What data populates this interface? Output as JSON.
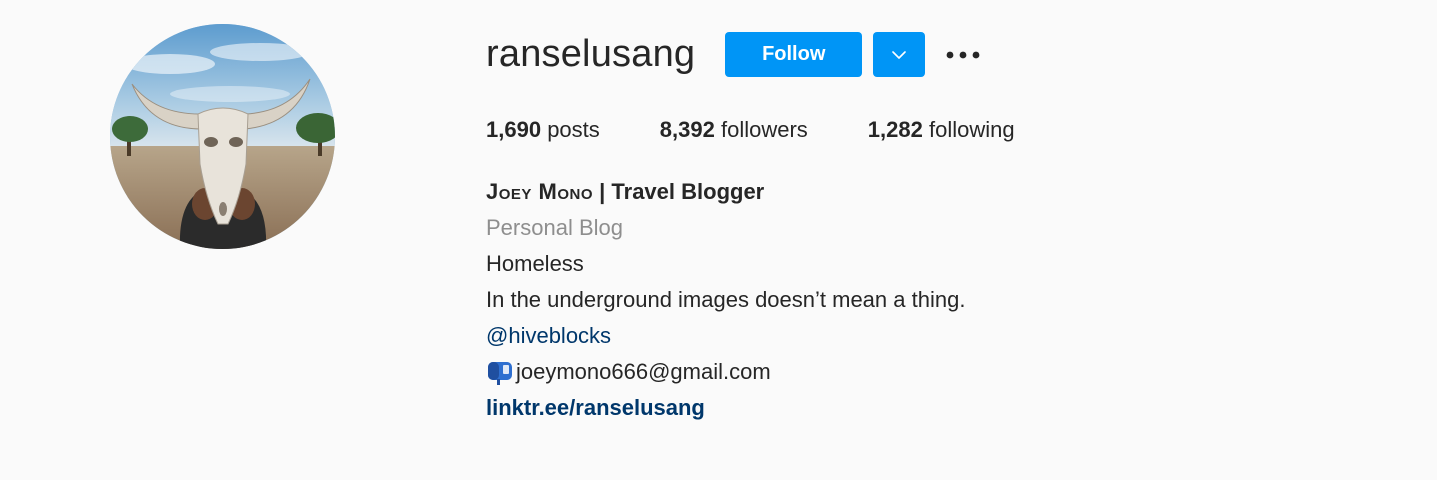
{
  "profile": {
    "username": "ranselusang",
    "follow_label": "Follow",
    "icons": {
      "dropdown": "chevron-down-icon",
      "more": "more-options-icon",
      "email_prefix": "mailbox-icon"
    }
  },
  "stats": {
    "posts_count": "1,690",
    "posts_label": "posts",
    "followers_count": "8,392",
    "followers_label": "followers",
    "following_count": "1,282",
    "following_label": "following"
  },
  "bio": {
    "name_caps": "Joey Mono",
    "name_rest": " | Travel Blogger",
    "category": "Personal Blog",
    "line1": "Homeless",
    "line2": "In the underground images doesn’t mean a thing.",
    "mention": "@hiveblocks",
    "email": "joeymono666@gmail.com",
    "link": "linktr.ee/ranselusang"
  },
  "colors": {
    "background": "#fafafa",
    "primary_button": "#0095f6",
    "link": "#00376b",
    "muted": "#8e8e8e",
    "text": "#262626"
  }
}
